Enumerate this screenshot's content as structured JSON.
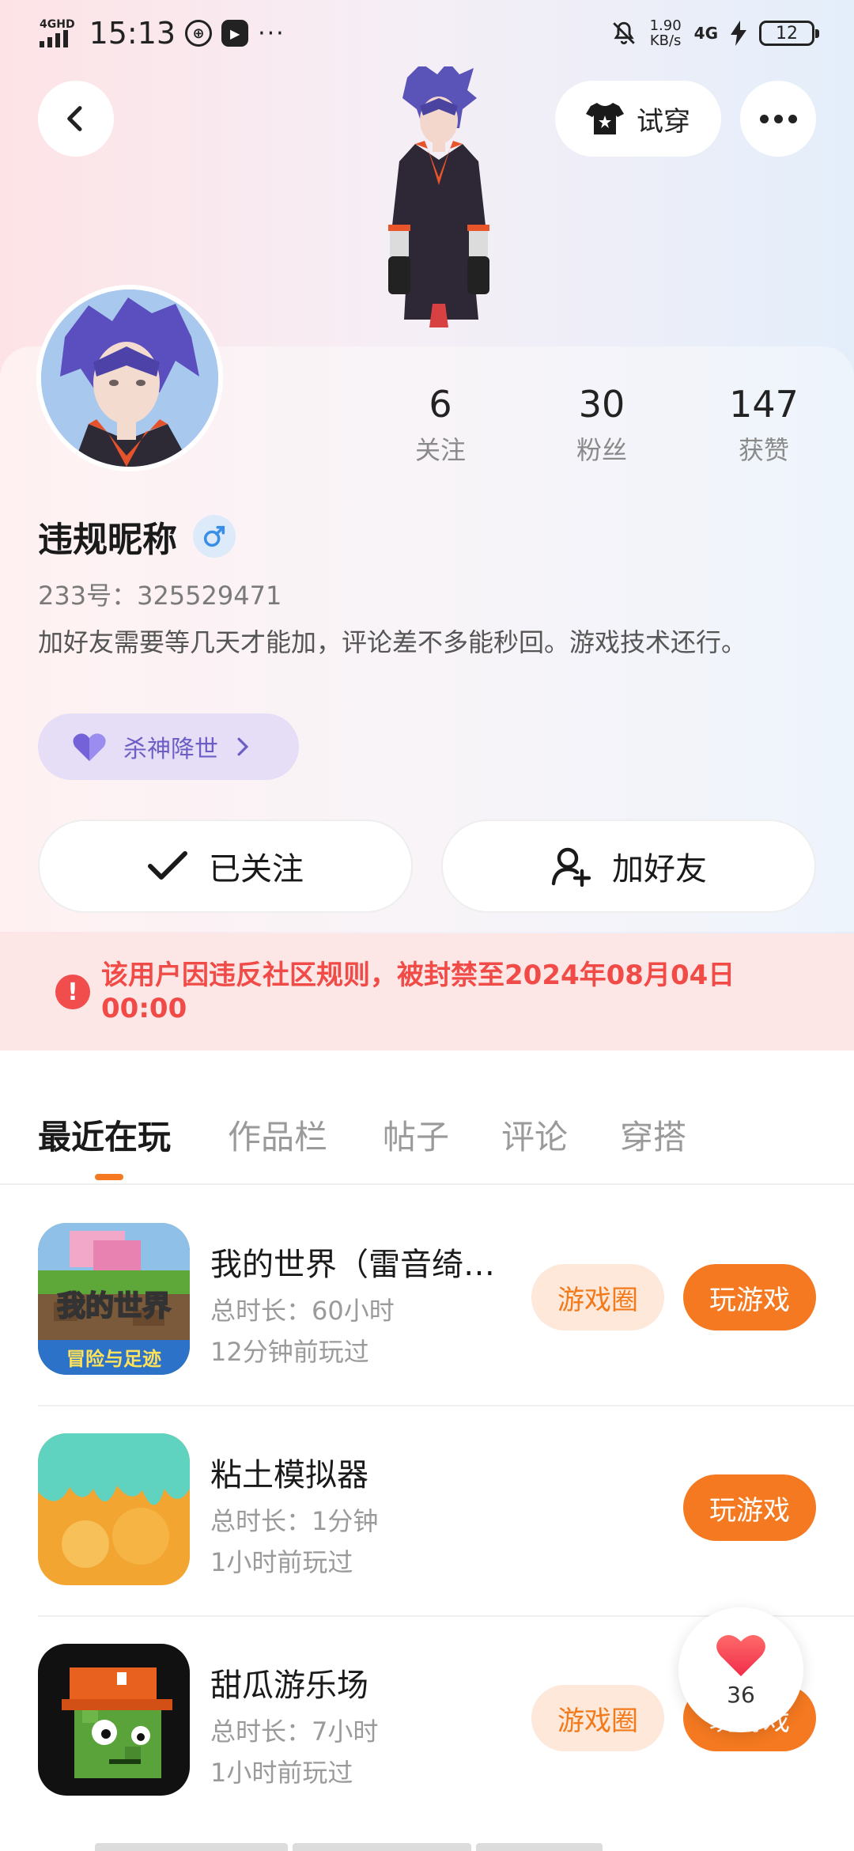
{
  "status_bar": {
    "network": "4GHD",
    "time": "15:13",
    "net_speed_value": "1.90",
    "net_speed_unit": "KB/s",
    "network_type": "4G",
    "battery": "12"
  },
  "header": {
    "try_on_label": "试穿"
  },
  "profile": {
    "following_count": "6",
    "following_label": "关注",
    "fans_count": "30",
    "fans_label": "粉丝",
    "likes_count": "147",
    "likes_label": "获赞",
    "nickname": "违规昵称",
    "gender_icon": "male-icon",
    "uid": "233号：325529471",
    "bio": "加好友需要等几天才能加，评论差不多能秒回。游戏技术还行。",
    "medal_label": "杀神降世",
    "follow_state_label": "已关注",
    "add_friend_label": "加好友"
  },
  "ban_notice": {
    "text": "该用户因违反社区规则，被封禁至2024年08月04日00:00"
  },
  "tabs": [
    {
      "label": "最近在玩",
      "active": true
    },
    {
      "label": "作品栏",
      "active": false
    },
    {
      "label": "帖子",
      "active": false
    },
    {
      "label": "评论",
      "active": false
    },
    {
      "label": "穿搭",
      "active": false
    }
  ],
  "games": [
    {
      "title": "我的世界（雷音绮…",
      "duration": "总时长：60小时",
      "last_played": "12分钟前玩过",
      "circle_label": "游戏圈",
      "play_label": "玩游戏",
      "icon_text_top": "我的世界",
      "icon_text_bottom": "冒险与足迹"
    },
    {
      "title": "粘土模拟器",
      "duration": "总时长：1分钟",
      "last_played": "1小时前玩过",
      "play_label": "玩游戏"
    },
    {
      "title": "甜瓜游乐场",
      "duration": "总时长：7小时",
      "last_played": "1小时前玩过",
      "circle_label": "游戏圈",
      "play_label": "玩游戏"
    }
  ],
  "like_button": {
    "count": "36"
  },
  "colors": {
    "accent": "#f47920",
    "ban_text": "#f04b47",
    "medal_text": "#6c5ec4"
  }
}
